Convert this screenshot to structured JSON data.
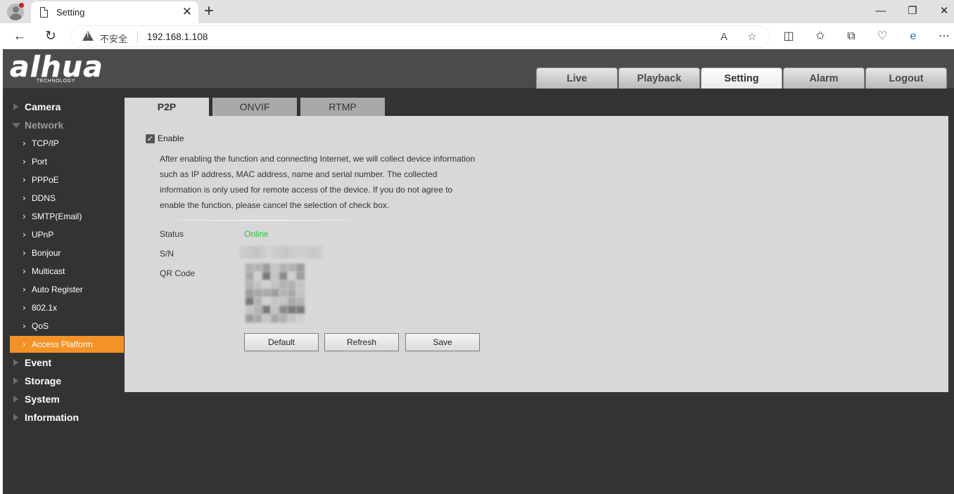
{
  "browser": {
    "tab_title": "Setting",
    "tab_close": "✕",
    "new_tab": "+",
    "insecure_label": "不安全",
    "url": "192.168.1.108",
    "window_controls": {
      "minimize": "—",
      "restore": "❐",
      "close": "✕"
    }
  },
  "app": {
    "logo": "alhua",
    "logo_sub": "TECHNOLOGY",
    "nav_tabs": [
      "Live",
      "Playback",
      "Setting",
      "Alarm",
      "Logout"
    ],
    "active_nav": "Setting"
  },
  "sidebar": {
    "sections": [
      {
        "label": "Camera",
        "expanded": false
      },
      {
        "label": "Network",
        "expanded": true
      },
      {
        "label": "Event",
        "expanded": false
      },
      {
        "label": "Storage",
        "expanded": false
      },
      {
        "label": "System",
        "expanded": false
      },
      {
        "label": "Information",
        "expanded": false
      }
    ],
    "network_items": [
      "TCP/IP",
      "Port",
      "PPPoE",
      "DDNS",
      "SMTP(Email)",
      "UPnP",
      "Bonjour",
      "Multicast",
      "Auto Register",
      "802.1x",
      "QoS",
      "Access Platform"
    ],
    "active_item": "Access Platform",
    "active_color": "#f39327"
  },
  "content": {
    "tabs": [
      "P2P",
      "ONVIF",
      "RTMP"
    ],
    "active_tab": "P2P",
    "enable_label": "Enable",
    "enable_checked": true,
    "description": [
      "After enabling the function and connecting Internet, we will collect device information",
      "such as IP address, MAC address, name and serial number. The collected",
      "information is only used for remote access of the device. If you do not agree to",
      "enable the function, please cancel the selection of check box."
    ],
    "status_label": "Status",
    "status_value": "Online",
    "status_color": "#2cc62c",
    "sn_label": "S/N",
    "qr_label": "QR Code",
    "buttons": [
      "Default",
      "Refresh",
      "Save"
    ]
  }
}
